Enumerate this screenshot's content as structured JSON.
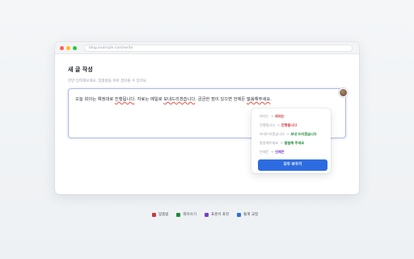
{
  "browser": {
    "url": "blog.example.com/write"
  },
  "page": {
    "title": "새 글 작성",
    "subtitle": "한번 입력해보세요. 맞춤법을 바로 잡아줄 수 있어요."
  },
  "editor": {
    "segments": [
      {
        "text": "오늘 회의는 예정대로 ",
        "error": false
      },
      {
        "text": "진행됩니다",
        "error": true
      },
      {
        "text": ". 자료는 메일로 ",
        "error": false
      },
      {
        "text": "보내드리겠습니다",
        "error": true
      },
      {
        "text": ". 궁금한 점이 있으면 언제든 ",
        "error": false
      },
      {
        "text": "말씀해주세요",
        "error": true
      },
      {
        "text": ".",
        "error": false
      }
    ]
  },
  "suggestions": {
    "items": [
      {
        "from": "회의는",
        "to": "회의는",
        "type": "red"
      },
      {
        "from": "진행됩니다",
        "to": "진행됩니다",
        "type": "red"
      },
      {
        "from": "보내드리겠습니다",
        "to": "보내 드리겠습니다",
        "type": "green"
      },
      {
        "from": "말씀해주세요",
        "to": "말씀해 주세요",
        "type": "green"
      },
      {
        "from": "언제든",
        "to": "언제든",
        "type": "purple"
      }
    ],
    "fix_all_label": "모두 바꾸기"
  },
  "legend": {
    "items": [
      {
        "label": "맞춤법",
        "color": "#d1383d"
      },
      {
        "label": "띄어쓰기",
        "color": "#1f8a3b"
      },
      {
        "label": "표준어 표현",
        "color": "#7b3fc7"
      },
      {
        "label": "통계 교정",
        "color": "#2f6fd6"
      }
    ]
  }
}
